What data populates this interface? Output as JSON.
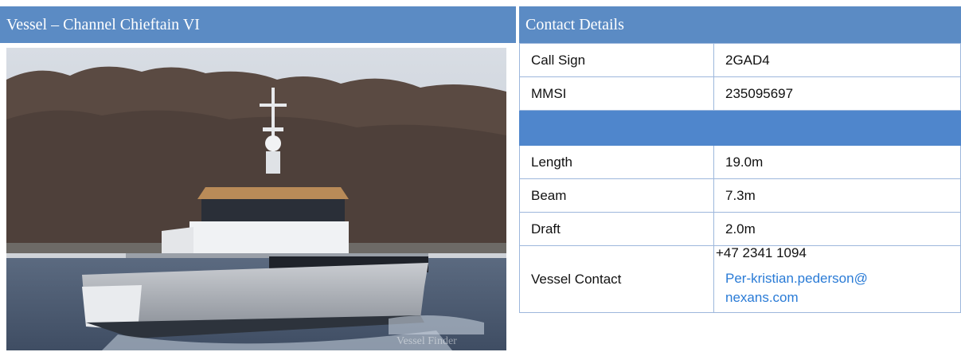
{
  "left_panel": {
    "header_title": "Vessel – Channel Chieftain VI",
    "photo": {
      "watermark": "Vessel Finder"
    }
  },
  "right_panel": {
    "header_title": "Contact Details",
    "rows": [
      {
        "label": "Call Sign",
        "value": "2GAD4"
      },
      {
        "label": "MMSI",
        "value": "235095697"
      },
      {
        "label": "Length",
        "value": "19.0m"
      },
      {
        "label": "Beam",
        "value": "7.3m"
      },
      {
        "label": "Draft",
        "value": "2.0m"
      }
    ],
    "vessel_contact": {
      "label": "Vessel Contact",
      "phone": "+47 2341 1094",
      "email_line1": "Per-kristian.pederson@",
      "email_line2": "nexans.com"
    }
  },
  "colors": {
    "header_bg": "#5b8bc4",
    "band_bg": "#4f86cc",
    "border": "#9db7dc",
    "link": "#2a7bd6"
  }
}
